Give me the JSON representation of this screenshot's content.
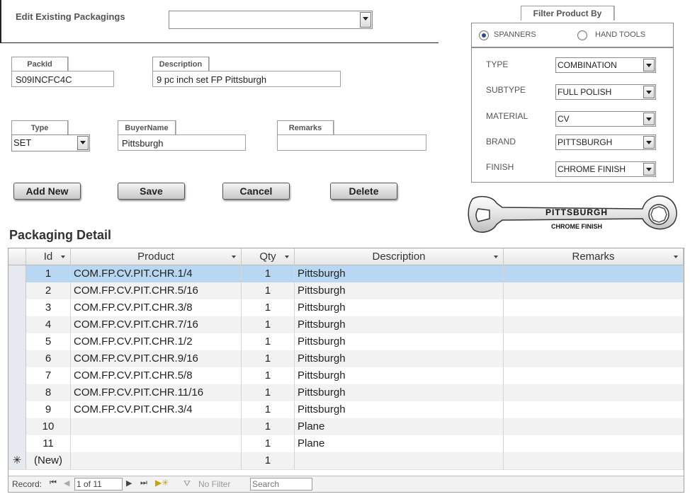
{
  "header": {
    "edit_label": "Edit Existing Packagings",
    "edit_value": ""
  },
  "form": {
    "packid": {
      "label": "PackId",
      "value": "S09INCFC4C"
    },
    "description": {
      "label": "Description",
      "value": "9 pc inch set FP Pittsburgh"
    },
    "type": {
      "label": "Type",
      "value": "SET"
    },
    "buyer": {
      "label": "BuyerName",
      "value": "Pittsburgh"
    },
    "remarks": {
      "label": "Remarks",
      "value": ""
    }
  },
  "buttons": {
    "add": "Add New",
    "save": "Save",
    "cancel": "Cancel",
    "delete": "Delete"
  },
  "filter": {
    "title": "Filter Product By",
    "options": [
      "SPANNERS",
      "HAND TOOLS"
    ],
    "selected": "SPANNERS",
    "fields": [
      {
        "label": "TYPE",
        "value": "COMBINATION"
      },
      {
        "label": "SUBTYPE",
        "value": "FULL POLISH"
      },
      {
        "label": "MATERIAL",
        "value": "CV"
      },
      {
        "label": "BRAND",
        "value": "PITTSBURGH"
      },
      {
        "label": "FINISH",
        "value": "CHROME FINISH"
      }
    ]
  },
  "image": {
    "brand": "PITTSBURGH",
    "finish": "CHROME FINISH"
  },
  "detail": {
    "title": "Packaging Detail",
    "columns": [
      "Id",
      "Product",
      "Qty",
      "Description",
      "Remarks"
    ],
    "rows": [
      {
        "id": "1",
        "product": "COM.FP.CV.PIT.CHR.1/4",
        "qty": "1",
        "description": "Pittsburgh",
        "remarks": ""
      },
      {
        "id": "2",
        "product": "COM.FP.CV.PIT.CHR.5/16",
        "qty": "1",
        "description": "Pittsburgh",
        "remarks": ""
      },
      {
        "id": "3",
        "product": "COM.FP.CV.PIT.CHR.3/8",
        "qty": "1",
        "description": "Pittsburgh",
        "remarks": ""
      },
      {
        "id": "4",
        "product": "COM.FP.CV.PIT.CHR.7/16",
        "qty": "1",
        "description": "Pittsburgh",
        "remarks": ""
      },
      {
        "id": "5",
        "product": "COM.FP.CV.PIT.CHR.1/2",
        "qty": "1",
        "description": "Pittsburgh",
        "remarks": ""
      },
      {
        "id": "6",
        "product": "COM.FP.CV.PIT.CHR.9/16",
        "qty": "1",
        "description": "Pittsburgh",
        "remarks": ""
      },
      {
        "id": "7",
        "product": "COM.FP.CV.PIT.CHR.5/8",
        "qty": "1",
        "description": "Pittsburgh",
        "remarks": ""
      },
      {
        "id": "8",
        "product": "COM.FP.CV.PIT.CHR.11/16",
        "qty": "1",
        "description": "Pittsburgh",
        "remarks": ""
      },
      {
        "id": "9",
        "product": "COM.FP.CV.PIT.CHR.3/4",
        "qty": "1",
        "description": "Pittsburgh",
        "remarks": ""
      },
      {
        "id": "10",
        "product": "",
        "qty": "1",
        "description": "Plane",
        "remarks": ""
      },
      {
        "id": "11",
        "product": "",
        "qty": "1",
        "description": "Plane",
        "remarks": ""
      }
    ],
    "new_row": {
      "id": "(New)",
      "qty": "1",
      "marker": "✳"
    }
  },
  "navigation": {
    "record_label": "Record:",
    "position": "1 of 11",
    "filter_label": "No Filter",
    "search_placeholder": "Search"
  },
  "colors": {
    "selected_row": "#b7d7f2",
    "alt_row": "#f2f2f2"
  }
}
